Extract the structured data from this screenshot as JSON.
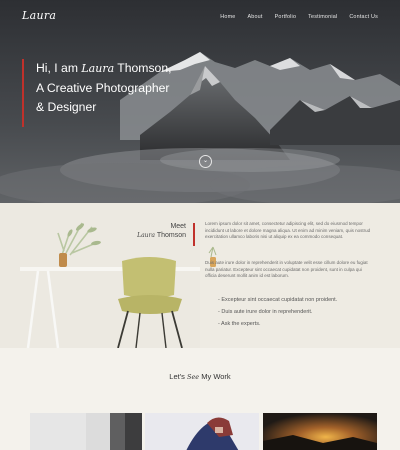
{
  "brand": "Laura",
  "nav": [
    "Home",
    "About",
    "Portfolio",
    "Testimonial",
    "Contact Us"
  ],
  "hero": {
    "line1_prefix": "Hi, I am ",
    "line1_name": "Laura",
    "line1_suffix": " Thomson,",
    "line2": "A Creative Photographer",
    "line3": "& Designer",
    "scroll_icon": "⌄"
  },
  "about": {
    "meet": "Meet",
    "meet_name": "Laura",
    "meet_surname": " Thomson",
    "paragraph1": "Lorem ipsum dolor sit amet, consectetur adipiscing elit, sed do eiusmod tempor incididunt ut labore et dolore magna aliqua. Ut enim ad minim veniam, quis nostrud exercitation ullamco laboris nisi ut aliquip ex ea commodo consequat.",
    "paragraph2": "Duis aute irure dolor in reprehenderit in voluptate velit esse cillum dolore eu fugiat nulla pariatur. Excepteur sint occaecat cupidatat non proident, sunt in culpa qui officia deserunt mollit anim id est laborum.",
    "bullets": [
      "- Excepteur sint occaecat cupidatat non proident.",
      "- Duis aute irure dolor in reprehenderit.",
      "- Ask the experts."
    ]
  },
  "work": {
    "prefix": "Let's ",
    "script": "See",
    "suffix": " My Work"
  },
  "colors": {
    "accent": "#c0312b",
    "chair": "#c3bf72"
  }
}
